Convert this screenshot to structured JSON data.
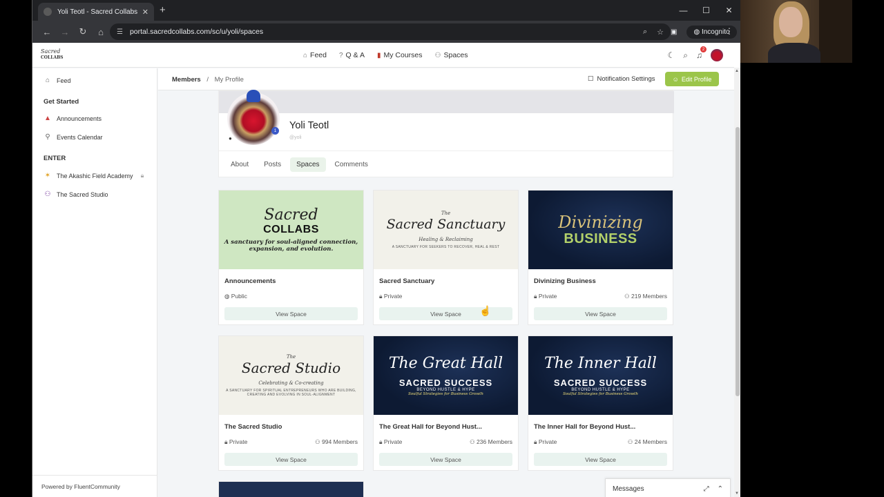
{
  "browser": {
    "tab_title": "Yoli Teotl - Sacred Collabs Portal",
    "new_tab": "+",
    "url": "portal.sacredcollabs.com/sc/u/yoli/spaces",
    "incognito_label": "Incognito"
  },
  "logo": {
    "text_line1": "Sacred",
    "text_line2": "COLLABS"
  },
  "nav": {
    "items": [
      {
        "label": "Feed",
        "icon": "home-icon"
      },
      {
        "label": "Q & A",
        "icon": "question-icon"
      },
      {
        "label": "My Courses",
        "icon": "book-icon"
      },
      {
        "label": "Spaces",
        "icon": "people-icon"
      }
    ],
    "notification_count": "2"
  },
  "sidebar": {
    "feed": "Feed",
    "get_started": "Get Started",
    "announcements": "Announcements",
    "events": "Events Calendar",
    "enter": "ENTER",
    "akashic": "The Akashic Field Academy",
    "studio": "The Sacred Studio",
    "powered": "Powered by FluentCommunity"
  },
  "header": {
    "crumb_members": "Members",
    "crumb_sep": "/",
    "crumb_profile": "My Profile",
    "notification_settings": "Notification Settings",
    "edit_profile": "Edit Profile"
  },
  "profile": {
    "name": "Yoli Teotl",
    "handle": "@yoli",
    "badge": "1",
    "tabs": [
      "About",
      "Posts",
      "Spaces",
      "Comments"
    ],
    "active_tab": "Spaces"
  },
  "spaces": [
    {
      "name": "Announcements",
      "privacy": "Public",
      "members": "",
      "button": "View Space",
      "img": {
        "l1": "Sacred",
        "l2": "COLLABS",
        "l3": "A sanctuary for soul-aligned connection, expansion, and evolution."
      }
    },
    {
      "name": "Sacred Sanctuary",
      "privacy": "Private",
      "members": "",
      "button": "View Space",
      "img": {
        "l1": "The",
        "l2": "Sacred Sanctuary",
        "l3": "Healing & Reclaiming",
        "l4": "A SANCTUARY FOR SEEKERS TO RECOVER, HEAL & REST"
      }
    },
    {
      "name": "Divinizing Business",
      "privacy": "Private",
      "members": "219 Members",
      "button": "View Space",
      "img": {
        "l1": "Divinizing",
        "l2": "BUSINESS"
      }
    },
    {
      "name": "The Sacred Studio",
      "privacy": "Private",
      "members": "994 Members",
      "button": "View Space",
      "img": {
        "l1": "The",
        "l2": "Sacred Studio",
        "l3": "Celebrating & Co-creating",
        "l4": "A SANCTUARY FOR SPIRITUAL ENTREPRENEURS WHO ARE BUILDING, CREATING AND EVOLVING IN SOUL-ALIGNMENT"
      }
    },
    {
      "name": "The Great Hall for Beyond Hust...",
      "privacy": "Private",
      "members": "236 Members",
      "button": "View Space",
      "img": {
        "l1": "The Great Hall",
        "l2": "SACRED SUCCESS",
        "l3": "BEYOND HUSTLE & HYPE",
        "l4": "Soulful Strategies for Business Growth"
      }
    },
    {
      "name": "The Inner Hall for Beyond Hust...",
      "privacy": "Private",
      "members": "24 Members",
      "button": "View Space",
      "img": {
        "l1": "The Inner Hall",
        "l2": "SACRED SUCCESS",
        "l3": "BEYOND HUSTLE & HYPE",
        "l4": "Soulful Strategies for Business Growth"
      }
    }
  ],
  "messages": {
    "label": "Messages"
  },
  "colors": {
    "accent": "#9bc54a",
    "button_bg": "#e9f3ef",
    "navy": "#0d1a33"
  }
}
